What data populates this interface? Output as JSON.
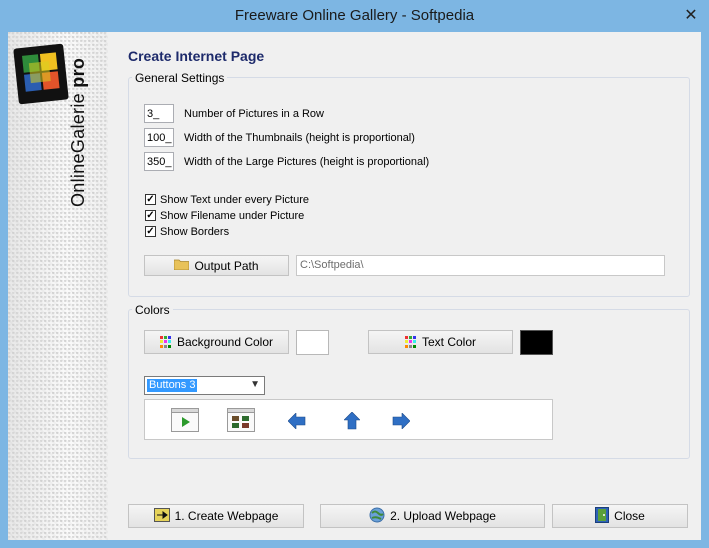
{
  "window": {
    "title": "Freeware Online Gallery - Softpedia",
    "close_glyph": "✕"
  },
  "sidebar": {
    "logo_text": "OnlineGalerie",
    "logo_suffix": "pro"
  },
  "page": {
    "heading": "Create Internet Page",
    "general_settings": {
      "legend": "General Settings",
      "pictures_per_row": {
        "value": "3_",
        "label": "Number of Pictures in a Row"
      },
      "thumb_width": {
        "value": "100_",
        "label": "Width of the Thumbnails (height is proportional)"
      },
      "large_width": {
        "value": "350_",
        "label": "Width of the Large Pictures (height is proportional)"
      },
      "checkboxes": [
        {
          "label": "Show Text under every Picture",
          "checked": true
        },
        {
          "label": "Show Filename under Picture",
          "checked": true
        },
        {
          "label": "Show Borders",
          "checked": true
        }
      ],
      "output_path_button": "Output Path",
      "output_path_value": "C:\\Softpedia\\"
    },
    "colors": {
      "legend": "Colors",
      "background_button": "Background Color",
      "background_value": "#ffffff",
      "text_button": "Text Color",
      "text_value": "#000000",
      "buttons_select": "Buttons 3"
    },
    "footer": {
      "create_button": "1. Create Webpage",
      "upload_button": "2. Upload Webpage",
      "close_button": "Close"
    }
  },
  "icons": [
    "folder-icon",
    "palette-icon",
    "play-icon",
    "gallery-icon",
    "arrow-left-icon",
    "arrow-up-icon",
    "arrow-right-icon",
    "create-icon",
    "upload-icon",
    "close-door-icon"
  ]
}
